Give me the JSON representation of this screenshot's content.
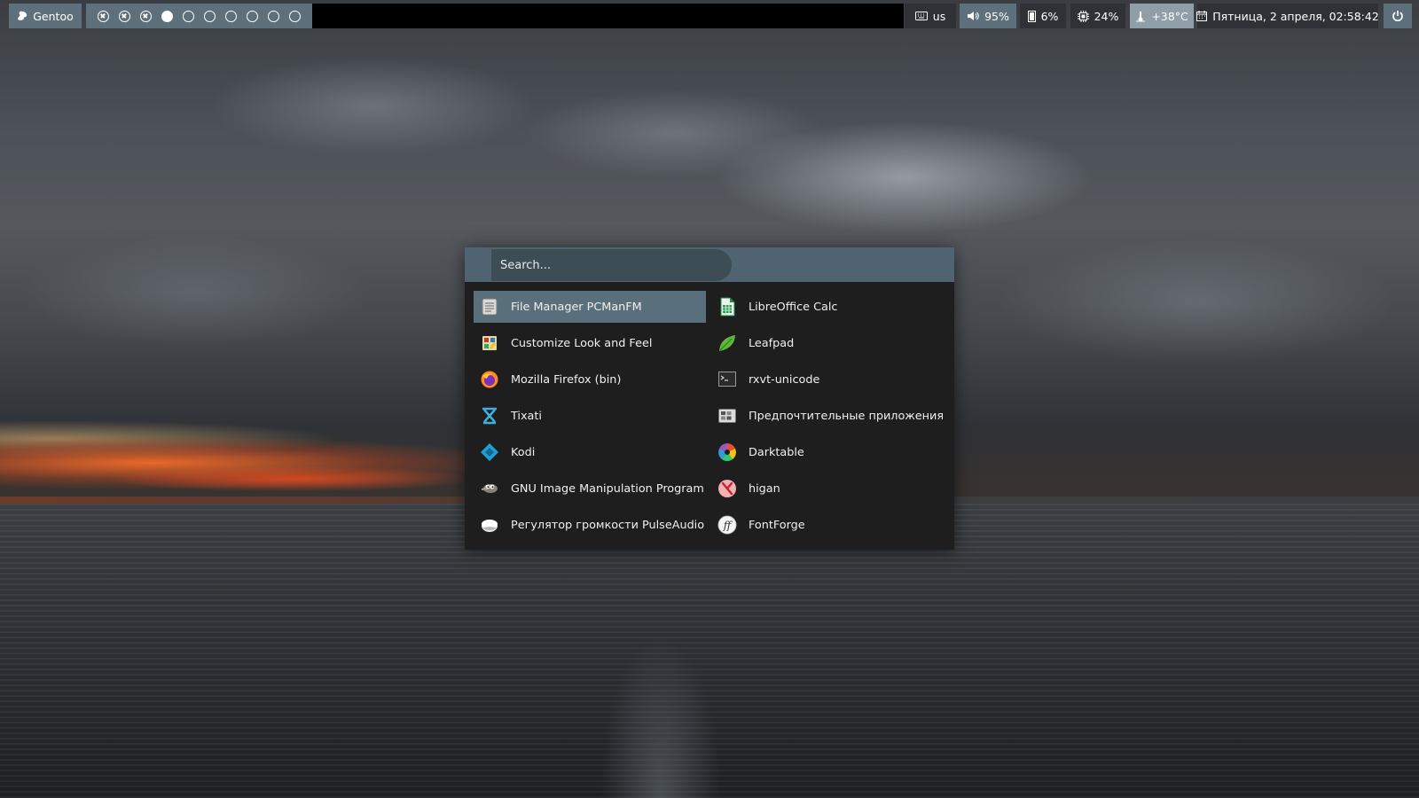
{
  "panel": {
    "distro_label": "Gentoo",
    "workspaces": [
      {
        "state": "closed"
      },
      {
        "state": "closed"
      },
      {
        "state": "closed"
      },
      {
        "state": "active"
      },
      {
        "state": "empty"
      },
      {
        "state": "empty"
      },
      {
        "state": "empty"
      },
      {
        "state": "empty"
      },
      {
        "state": "empty"
      },
      {
        "state": "empty"
      }
    ],
    "keyboard_layout": "us",
    "volume": "95%",
    "memory": "6%",
    "cpu": "24%",
    "temperature": "+38°C",
    "datetime": "Пятница,  2 апреля, 02:58:42",
    "icons": {
      "distro": "gentoo-logo-icon",
      "keyboard": "keyboard-icon",
      "volume": "speaker-icon",
      "memory": "memory-icon",
      "cpu": "cpu-chip-icon",
      "temperature": "thermometer-icon",
      "calendar": "calendar-icon",
      "power": "power-icon"
    }
  },
  "launcher": {
    "search_placeholder": "Search...",
    "apps_left": [
      {
        "label": "File Manager PCManFM",
        "icon": "file-manager-icon",
        "selected": true
      },
      {
        "label": "Customize Look and Feel",
        "icon": "appearance-icon"
      },
      {
        "label": "Mozilla Firefox (bin)",
        "icon": "firefox-icon"
      },
      {
        "label": "Tixati",
        "icon": "tixati-icon"
      },
      {
        "label": "Kodi",
        "icon": "kodi-icon"
      },
      {
        "label": "GNU Image Manipulation Program",
        "icon": "gimp-icon"
      },
      {
        "label": "Регулятор громкости PulseAudio",
        "icon": "pulseaudio-icon"
      }
    ],
    "apps_right": [
      {
        "label": "LibreOffice Calc",
        "icon": "libreoffice-calc-icon"
      },
      {
        "label": "Leafpad",
        "icon": "leafpad-icon"
      },
      {
        "label": "rxvt-unicode",
        "icon": "terminal-icon"
      },
      {
        "label": "Предпочтительные приложения",
        "icon": "preferred-apps-icon"
      },
      {
        "label": "Darktable",
        "icon": "darktable-icon"
      },
      {
        "label": "higan",
        "icon": "higan-icon"
      },
      {
        "label": "FontForge",
        "icon": "fontforge-icon"
      }
    ]
  },
  "colors": {
    "panel_steel": "#5e707b",
    "panel_dark": "#2e3236",
    "launcher_bg": "#1e1e1f",
    "launcher_header": "#4f6470",
    "selection": "#5a6f7c"
  }
}
